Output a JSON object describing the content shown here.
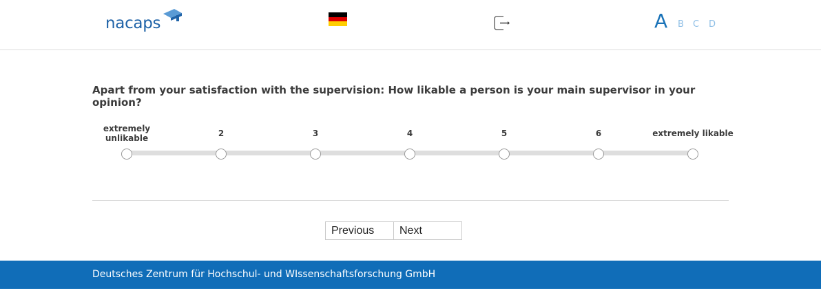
{
  "header": {
    "logo_text": "nacaps",
    "language_flag": "de-flag-icon",
    "logout_icon": "logout-icon",
    "font_sizes": [
      "A",
      "B",
      "C",
      "D"
    ],
    "colors": {
      "brand_blue": "#1f63a8",
      "font_size_active": "#1a73b8",
      "font_size_inactive": "#8fbfe6"
    }
  },
  "question": {
    "text": "Apart from your satisfaction with the supervision: How likable a person is your main supervisor in your opinion?",
    "scale": [
      {
        "label": "extremely unlikable",
        "lines": [
          "extremely",
          "unlikable"
        ]
      },
      {
        "label": "2",
        "lines": [
          "2"
        ]
      },
      {
        "label": "3",
        "lines": [
          "3"
        ]
      },
      {
        "label": "4",
        "lines": [
          "4"
        ]
      },
      {
        "label": "5",
        "lines": [
          "5"
        ]
      },
      {
        "label": "6",
        "lines": [
          "6"
        ]
      },
      {
        "label": "extremely likable",
        "lines": [
          "extremely likable"
        ]
      }
    ],
    "selected": null
  },
  "navigation": {
    "previous_label": "Previous",
    "next_label": "Next"
  },
  "footer": {
    "text": "Deutsches Zentrum für Hochschul- und WIssenschaftsforschung GmbH",
    "color": "#106db8"
  }
}
